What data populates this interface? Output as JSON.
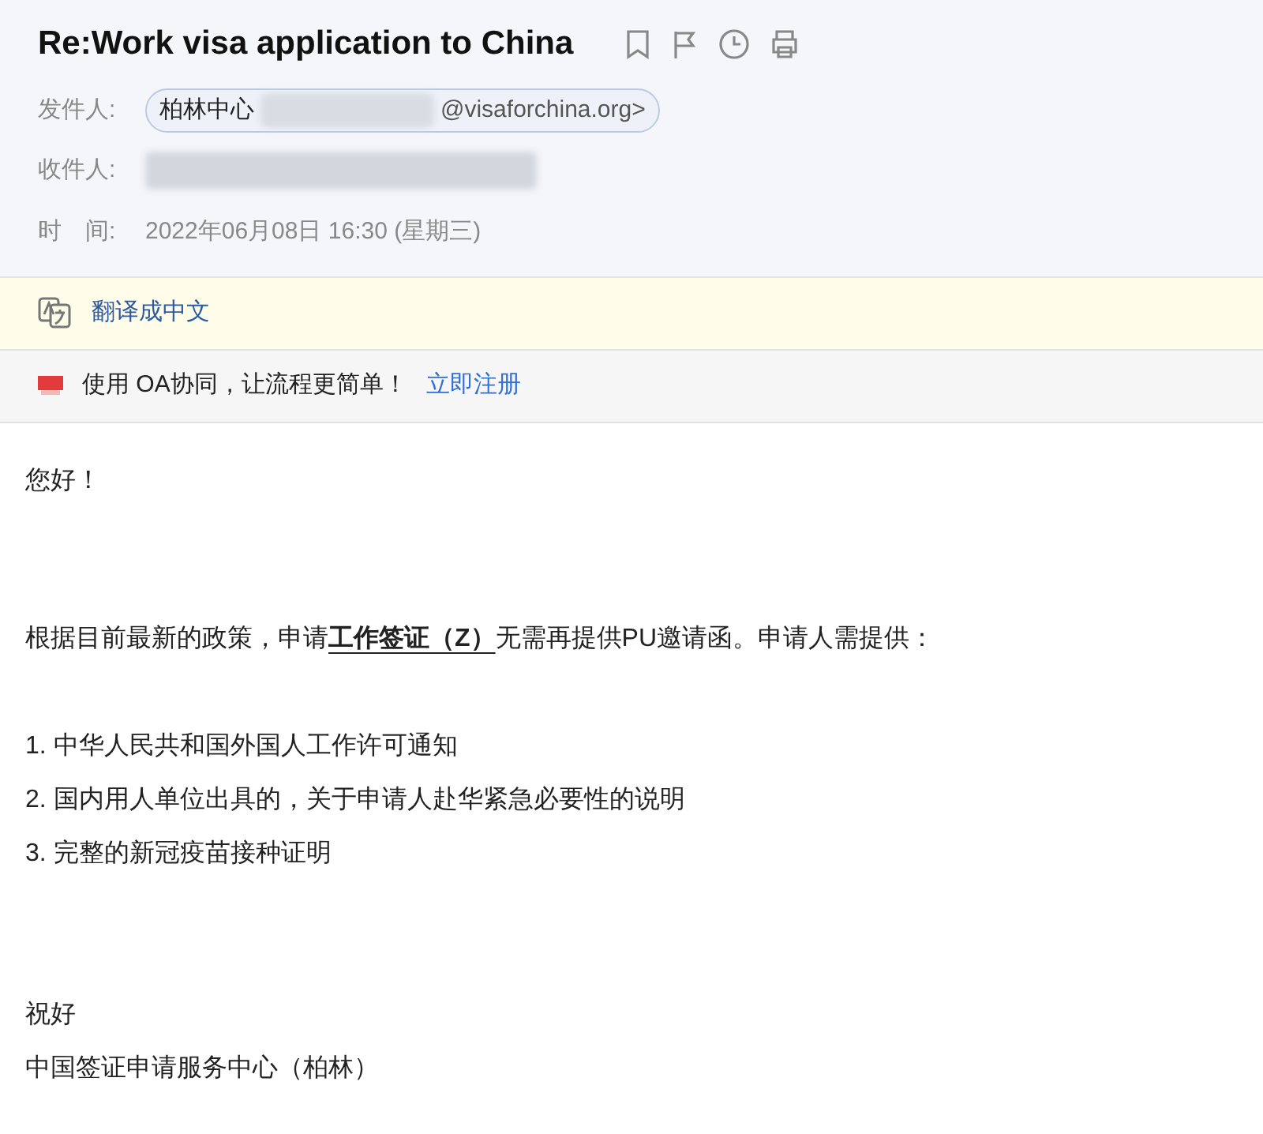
{
  "email": {
    "subject": "Re:Work visa application to China",
    "from": {
      "label": "发件人:",
      "name": "柏林中心",
      "address": "@visaforchina.org>"
    },
    "to": {
      "label": "收件人:"
    },
    "time": {
      "label": "时　间:",
      "value": "2022年06月08日 16:30 (星期三)"
    }
  },
  "translate_bar": {
    "text": "翻译成中文"
  },
  "promo_bar": {
    "text": "使用 OA协同，让流程更简单！",
    "link": "立即注册"
  },
  "body": {
    "greeting": "您好！",
    "paragraph": "根据目前最新的政策，申请**工作签证（Z）**无需再提供PU邀请函。申请人需提供：",
    "items": [
      "1. 中华人民共和国外国人工作许可通知",
      "2. 国内用人单位出具的，关于申请人赴华紧急必要性的说明",
      "3. 完整的新冠疫苗接种证明"
    ],
    "closing": "祝好",
    "signature": "中国签证申请服务中心（柏林）"
  }
}
